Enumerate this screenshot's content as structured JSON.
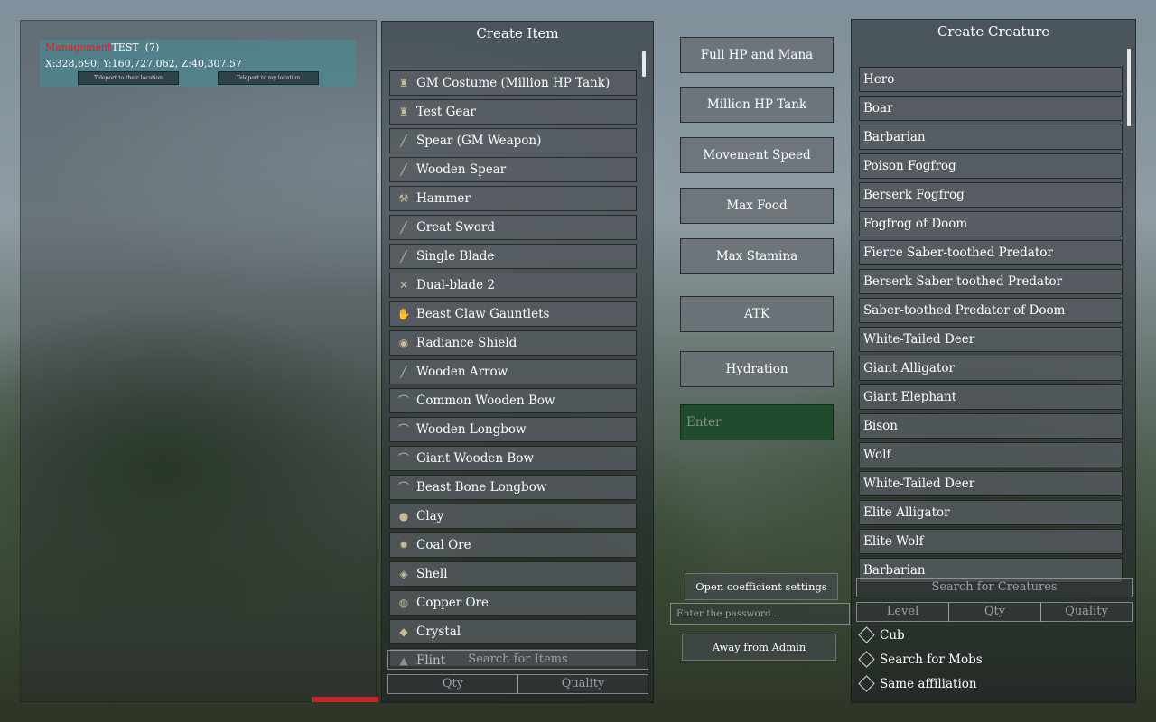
{
  "player": {
    "guild": "Management",
    "name": "TEST",
    "level": "(7)",
    "coords": "X:328,690, Y:160,727.062, Z:40,307.57",
    "teleport_to_them": "Teleport to their location",
    "teleport_to_me": "Teleport to my location"
  },
  "create_item": {
    "title": "Create Item",
    "items": [
      {
        "label": "GM Costume (Million HP Tank)",
        "icon": "armor-icon"
      },
      {
        "label": "Test Gear",
        "icon": "armor-icon"
      },
      {
        "label": "Spear (GM Weapon)",
        "icon": "spear-icon"
      },
      {
        "label": "Wooden Spear",
        "icon": "spear-icon"
      },
      {
        "label": "Hammer",
        "icon": "hammer-icon"
      },
      {
        "label": "Great Sword",
        "icon": "sword-icon"
      },
      {
        "label": "Single Blade",
        "icon": "blade-icon"
      },
      {
        "label": "Dual-blade 2",
        "icon": "dual-blade-icon"
      },
      {
        "label": "Beast Claw Gauntlets",
        "icon": "gauntlet-icon"
      },
      {
        "label": "Radiance Shield",
        "icon": "shield-icon"
      },
      {
        "label": "Wooden Arrow",
        "icon": "arrow-icon"
      },
      {
        "label": "Common Wooden Bow",
        "icon": "bow-icon"
      },
      {
        "label": "Wooden Longbow",
        "icon": "bow-icon"
      },
      {
        "label": "Giant Wooden Bow",
        "icon": "bow-icon"
      },
      {
        "label": "Beast Bone Longbow",
        "icon": "bow-icon"
      },
      {
        "label": "Clay",
        "icon": "clay-icon"
      },
      {
        "label": "Coal Ore",
        "icon": "coal-icon"
      },
      {
        "label": "Shell",
        "icon": "shell-icon"
      },
      {
        "label": "Copper Ore",
        "icon": "ore-icon"
      },
      {
        "label": "Crystal",
        "icon": "crystal-icon"
      },
      {
        "label": "Flint",
        "icon": "flint-icon"
      }
    ],
    "search_placeholder": "Search for Items",
    "qty_placeholder": "Qty",
    "quality_placeholder": "Quality"
  },
  "actions": {
    "full_hp_mana": "Full HP and Mana",
    "million_hp_tank": "Million HP Tank",
    "movement_speed": "Movement Speed",
    "max_food": "Max Food",
    "max_stamina": "Max Stamina",
    "atk": "ATK",
    "hydration": "Hydration",
    "enter_placeholder": "Enter",
    "open_coefficient": "Open coefficient settings",
    "password_placeholder": "Enter the password...",
    "away_from_admin": "Away from Admin"
  },
  "create_creature": {
    "title": "Create Creature",
    "creatures": [
      "Hero",
      "Boar",
      "Barbarian",
      "Poison Fogfrog",
      "Berserk Fogfrog",
      "Fogfrog of Doom",
      "Fierce Saber-toothed Predator",
      "Berserk Saber-toothed Predator",
      "Saber-toothed Predator of Doom",
      "White-Tailed Deer",
      "Giant Alligator",
      "Giant Elephant",
      "Bison",
      "Wolf",
      "White-Tailed Deer",
      "Elite Alligator",
      "Elite Wolf",
      "Barbarian"
    ],
    "search_placeholder": "Search for Creatures",
    "level_placeholder": "Level",
    "qty_placeholder": "Qty",
    "quality_placeholder": "Quality",
    "options": [
      "Cub",
      "Search for Mobs",
      "Same affiliation"
    ]
  },
  "colors": {
    "guild_text": "#e02020",
    "enter_box": "#1f4a2c",
    "player_card": "#468c96"
  }
}
